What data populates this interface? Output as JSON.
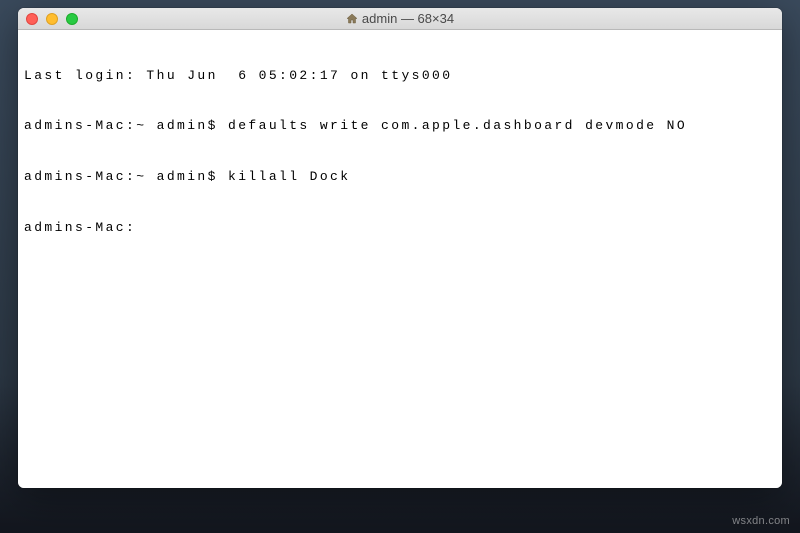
{
  "window": {
    "title": "admin — 68×34",
    "icon": "home-icon"
  },
  "traffic_lights": {
    "close": "close",
    "minimize": "minimize",
    "maximize": "maximize"
  },
  "terminal": {
    "lines": [
      "Last login: Thu Jun  6 05:02:17 on ttys000",
      "admins-Mac:~ admin$ defaults write com.apple.dashboard devmode NO",
      "admins-Mac:~ admin$ killall Dock",
      "admins-Mac:"
    ]
  },
  "watermark": "wsxdn.com"
}
